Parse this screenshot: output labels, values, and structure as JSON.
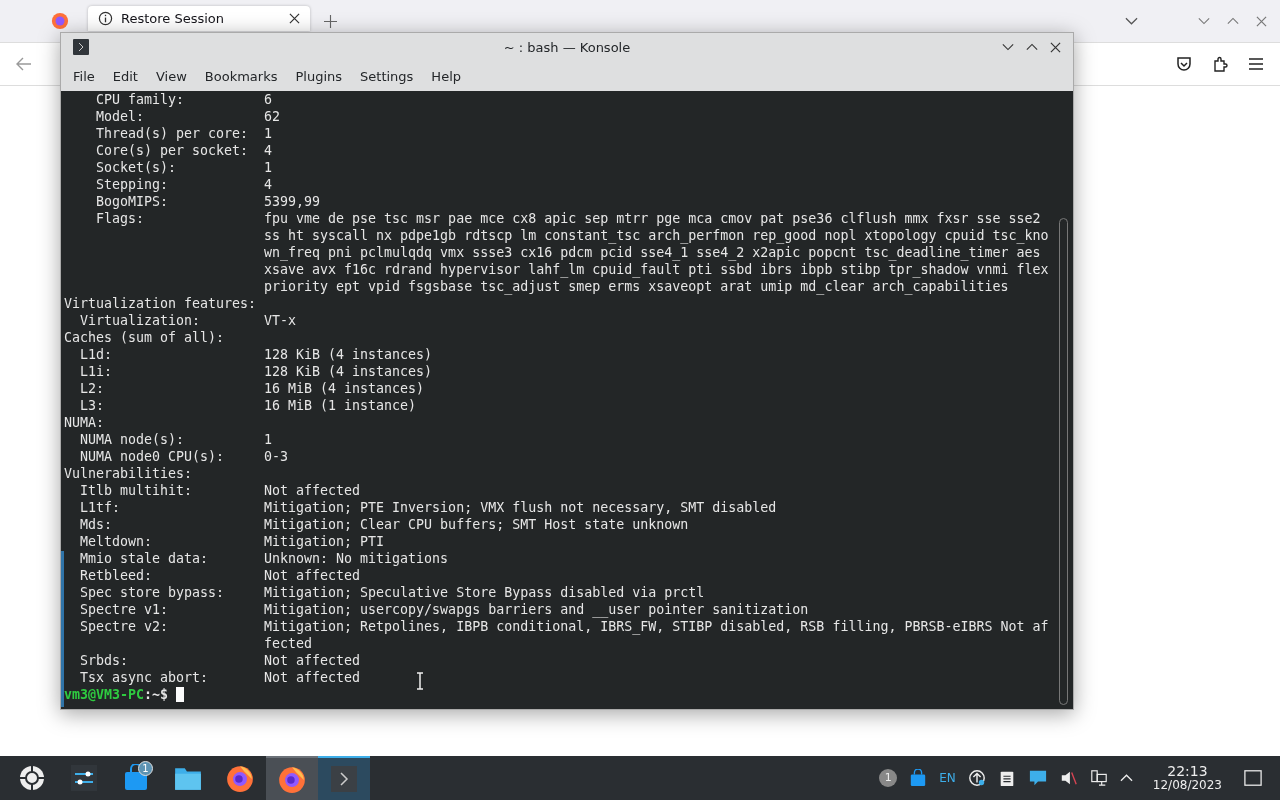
{
  "browser": {
    "tabs": [
      {
        "title": "Restore Session",
        "selected": true
      }
    ]
  },
  "konsole": {
    "title": "~ : bash — Konsole",
    "menu": [
      "File",
      "Edit",
      "View",
      "Bookmarks",
      "Plugins",
      "Settings",
      "Help"
    ],
    "sections": [
      {
        "kind": "subsection",
        "rows": [
          {
            "key": "CPU family:",
            "value_lines": [
              "6"
            ]
          },
          {
            "key": "Model:",
            "value_lines": [
              "62"
            ]
          },
          {
            "key": "Thread(s) per core:",
            "value_lines": [
              "1"
            ]
          },
          {
            "key": "Core(s) per socket:",
            "value_lines": [
              "4"
            ]
          },
          {
            "key": "Socket(s):",
            "value_lines": [
              "1"
            ]
          },
          {
            "key": "Stepping:",
            "value_lines": [
              "4"
            ]
          },
          {
            "key": "BogoMIPS:",
            "value_lines": [
              "5399,99"
            ]
          },
          {
            "key": "Flags:",
            "value_lines": [
              "fpu vme de pse tsc msr pae mce cx8 apic sep mtrr pge mca cmov pat pse36 clflush mmx fxsr sse sse2",
              "ss ht syscall nx pdpe1gb rdtscp lm constant_tsc arch_perfmon rep_good nopl xtopology cpuid tsc_kno",
              "wn_freq pni pclmulqdq vmx ssse3 cx16 pdcm pcid sse4_1 sse4_2 x2apic popcnt tsc_deadline_timer aes",
              "xsave avx f16c rdrand hypervisor lahf_lm cpuid_fault pti ssbd ibrs ibpb stibp tpr_shadow vnmi flex",
              "priority ept vpid fsgsbase tsc_adjust smep erms xsaveopt arat umip md_clear arch_capabilities"
            ]
          }
        ]
      },
      {
        "kind": "section",
        "heading": "Virtualization features:",
        "rows": [
          {
            "key": "Virtualization:",
            "value_lines": [
              "VT-x"
            ]
          }
        ]
      },
      {
        "kind": "section",
        "heading": "Caches (sum of all):",
        "rows": [
          {
            "key": "L1d:",
            "value_lines": [
              "128 KiB (4 instances)"
            ]
          },
          {
            "key": "L1i:",
            "value_lines": [
              "128 KiB (4 instances)"
            ]
          },
          {
            "key": "L2:",
            "value_lines": [
              "16 MiB (4 instances)"
            ]
          },
          {
            "key": "L3:",
            "value_lines": [
              "16 MiB (1 instance)"
            ]
          }
        ]
      },
      {
        "kind": "section",
        "heading": "NUMA:",
        "rows": [
          {
            "key": "NUMA node(s):",
            "value_lines": [
              "1"
            ]
          },
          {
            "key": "NUMA node0 CPU(s):",
            "value_lines": [
              "0-3"
            ]
          }
        ]
      },
      {
        "kind": "section",
        "heading": "Vulnerabilities:",
        "rows": [
          {
            "key": "Itlb multihit:",
            "value_lines": [
              "Not affected"
            ]
          },
          {
            "key": "L1tf:",
            "value_lines": [
              "Mitigation; PTE Inversion; VMX flush not necessary, SMT disabled"
            ]
          },
          {
            "key": "Mds:",
            "value_lines": [
              "Mitigation; Clear CPU buffers; SMT Host state unknown"
            ]
          },
          {
            "key": "Meltdown:",
            "value_lines": [
              "Mitigation; PTI"
            ]
          },
          {
            "key": "Mmio stale data:",
            "value_lines": [
              "Unknown: No mitigations"
            ]
          },
          {
            "key": "Retbleed:",
            "value_lines": [
              "Not affected"
            ]
          },
          {
            "key": "Spec store bypass:",
            "value_lines": [
              "Mitigation; Speculative Store Bypass disabled via prctl"
            ]
          },
          {
            "key": "Spectre v1:",
            "value_lines": [
              "Mitigation; usercopy/swapgs barriers and __user pointer sanitization"
            ]
          },
          {
            "key": "Spectre v2:",
            "value_lines": [
              "Mitigation; Retpolines, IBPB conditional, IBRS_FW, STIBP disabled, RSB filling, PBRSB-eIBRS Not af",
              "fected"
            ]
          },
          {
            "key": "Srbds:",
            "value_lines": [
              "Not affected"
            ]
          },
          {
            "key": "Tsx async abort:",
            "value_lines": [
              "Not affected"
            ]
          }
        ]
      }
    ],
    "prompt": {
      "user_host": "vm3@VM3-PC",
      "path": ":~$"
    }
  },
  "taskbar": {
    "apps": [
      {
        "kind": "launcher",
        "highlighted": false,
        "selected": false
      },
      {
        "kind": "settings",
        "highlighted": false,
        "selected": false
      },
      {
        "kind": "store",
        "highlighted": false,
        "selected": false,
        "badge": "1"
      },
      {
        "kind": "files",
        "highlighted": false,
        "selected": false
      },
      {
        "kind": "firefox",
        "highlighted": false,
        "selected": false
      },
      {
        "kind": "firefox",
        "highlighted": true,
        "selected": false
      },
      {
        "kind": "terminal",
        "highlighted": false,
        "selected": true
      }
    ],
    "tray_badge": "1",
    "language": "EN",
    "time": "22:13",
    "date": "12/08/2023"
  }
}
